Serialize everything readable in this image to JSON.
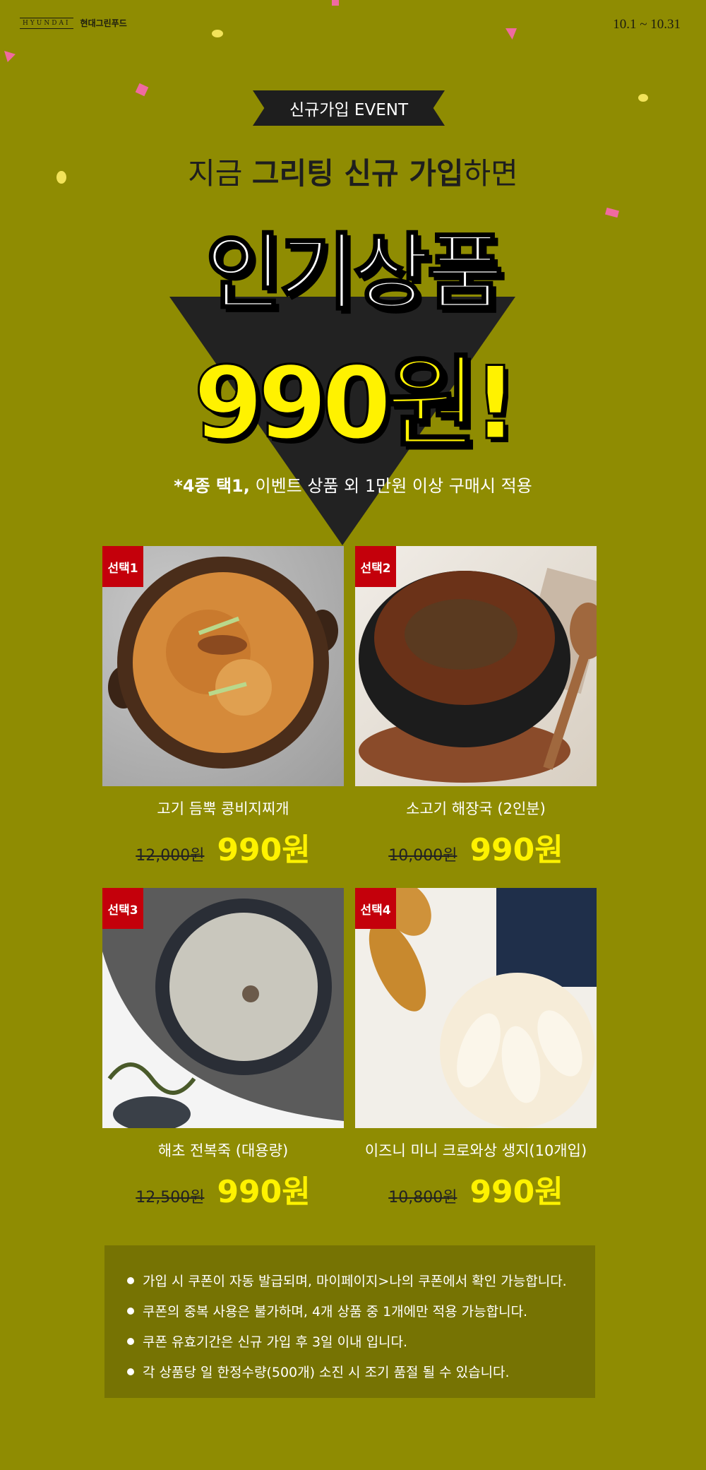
{
  "header": {
    "logo_mark": "HYUNDAI",
    "brand": "현대그린푸드",
    "date_range": "10.1 ~ 10.31"
  },
  "event": {
    "ribbon": "신규가입 EVENT",
    "subtitle_pre": "지금 ",
    "subtitle_bold": "그리팅 신규 가입",
    "subtitle_post": "하면",
    "headline": "인기상품",
    "price": "990원!",
    "condition_bold": "*4종 택1,",
    "condition_rest": " 이벤트 상품 외 1만원 이상 구매시 적용"
  },
  "products": [
    {
      "tag": "선택1",
      "name": "고기 듬뿍 콩비지찌개",
      "original_price": "12,000원",
      "sale_price": "990원"
    },
    {
      "tag": "선택2",
      "name": "소고기 해장국 (2인분)",
      "original_price": "10,000원",
      "sale_price": "990원"
    },
    {
      "tag": "선택3",
      "name": "해초 전복죽 (대용량)",
      "original_price": "12,500원",
      "sale_price": "990원"
    },
    {
      "tag": "선택4",
      "name": "이즈니 미니 크로와상 생지(10개입)",
      "original_price": "10,800원",
      "sale_price": "990원"
    }
  ],
  "notices": [
    "가입 시 쿠폰이 자동 발급되며, 마이페이지>나의 쿠폰에서 확인 가능합니다.",
    "쿠폰의 중복 사용은 불가하며, 4개 상품 중 1개에만 적용 가능합니다.",
    "쿠폰 유효기간은 신규 가입 후 3일 이내 입니다.",
    "각 상품당 일 한정수량(500개) 소진 시 조기 품절 될 수 있습니다."
  ],
  "colors": {
    "background": "#8f8c02",
    "accent_yellow": "#fff200",
    "tag_red": "#c4000b",
    "dark": "#222222"
  }
}
